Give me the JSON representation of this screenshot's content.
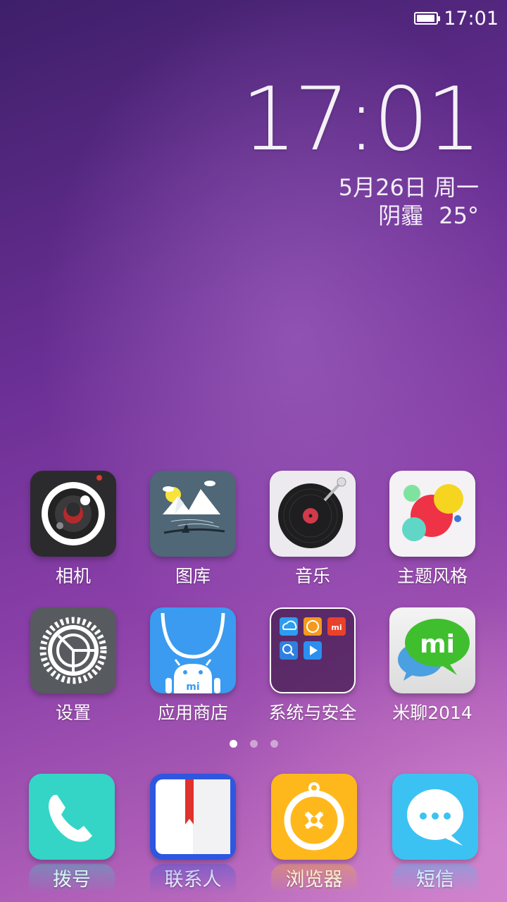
{
  "status_bar": {
    "time": "17:01",
    "battery_level": 0.95
  },
  "clock_widget": {
    "time": "17:01",
    "date": "5月26日 周一",
    "weather": "阴霾",
    "temperature": "25°"
  },
  "grid_apps": [
    {
      "label": "相机",
      "icon": "camera-icon"
    },
    {
      "label": "图库",
      "icon": "gallery-icon"
    },
    {
      "label": "音乐",
      "icon": "music-icon"
    },
    {
      "label": "主题风格",
      "icon": "themes-icon"
    },
    {
      "label": "设置",
      "icon": "settings-icon"
    },
    {
      "label": "应用商店",
      "icon": "app-store-icon"
    },
    {
      "label": "系统与安全",
      "icon": "folder-icon"
    },
    {
      "label": "米聊2014",
      "icon": "miliao-icon"
    }
  ],
  "folder_contents": [
    "cloud-icon",
    "mi-orange-icon",
    "mi-red-icon",
    "search-icon",
    "play-icon"
  ],
  "page_indicator": {
    "pages": 3,
    "current": 1
  },
  "dock_apps": [
    {
      "label": "拨号",
      "icon": "phone-icon"
    },
    {
      "label": "联系人",
      "icon": "contacts-icon"
    },
    {
      "label": "浏览器",
      "icon": "browser-icon"
    },
    {
      "label": "短信",
      "icon": "messages-icon"
    }
  ],
  "colors": {
    "phone": "#34d5c6",
    "contacts": "#2f56e0",
    "browser": "#ffb81c",
    "messages": "#3cc2f2",
    "app_store": "#3a9bf0"
  }
}
